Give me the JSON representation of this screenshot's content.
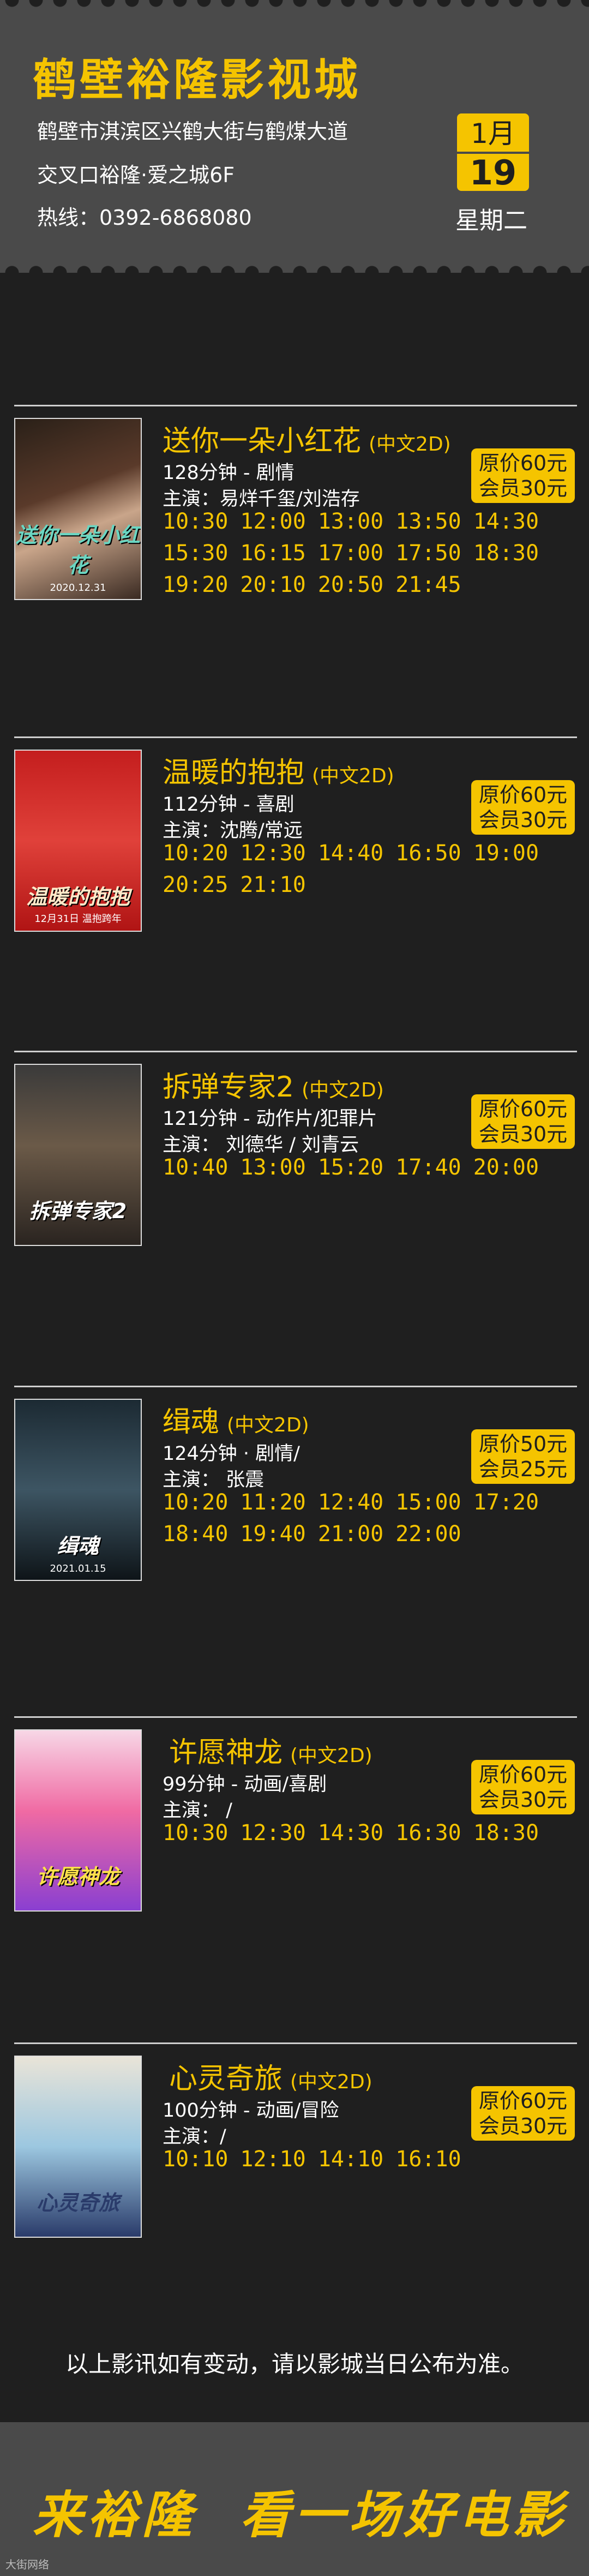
{
  "header": {
    "cinema_name": "鹤壁裕隆影视城",
    "address_line1": "鹤壁市淇滨区兴鹤大街与鹤煤大道",
    "address_line2": "交叉口裕隆·爱之城6F",
    "hotline": "热线：0392-6868080",
    "month": "1月",
    "day": "19",
    "weekday": "星期二"
  },
  "movies": [
    {
      "title": "送你一朵小红花",
      "format": "(中文2D)",
      "info": "128分钟 - 剧情",
      "cast": "主演：易烊千玺/刘浩存",
      "price_original": "原价60元",
      "price_member": "会员30元",
      "poster_title": "送你一朵小红花",
      "poster_date": "2020.12.31",
      "showtimes": [
        "10:30",
        "12:00",
        "13:00",
        "13:50",
        "14:30",
        "15:30",
        "16:15",
        "17:00",
        "17:50",
        "18:30",
        "19:20",
        "20:10",
        "20:50",
        "21:45"
      ]
    },
    {
      "title": "温暖的抱抱",
      "format": "(中文2D)",
      "info": "112分钟 - 喜剧",
      "cast": "主演：沈腾/常远",
      "price_original": "原价60元",
      "price_member": "会员30元",
      "poster_title": "温暖的抱抱",
      "poster_date": "12月31日 温抱跨年",
      "showtimes": [
        "10:20",
        "12:30",
        "14:40",
        "16:50",
        "19:00",
        "20:25",
        "21:10"
      ]
    },
    {
      "title": "拆弹专家2",
      "format": "(中文2D)",
      "info": "121分钟 - 动作片/犯罪片",
      "cast": "主演： 刘德华 / 刘青云",
      "price_original": "原价60元",
      "price_member": "会员30元",
      "poster_title": "拆弹专家2",
      "poster_date": "",
      "showtimes": [
        "10:40",
        "13:00",
        "15:20",
        "17:40",
        "20:00"
      ]
    },
    {
      "title": "缉魂",
      "format": "(中文2D)",
      "info": "124分钟 · 剧情/",
      "cast": "主演： 张震",
      "price_original": "原价50元",
      "price_member": "会员25元",
      "poster_title": "缉魂",
      "poster_date": "2021.01.15",
      "showtimes": [
        "10:20",
        "11:20",
        "12:40",
        "15:00",
        "17:20",
        "18:40",
        "19:40",
        "21:00",
        "22:00"
      ]
    },
    {
      "title": "许愿神龙",
      "format": "(中文2D)",
      "info": "99分钟 - 动画/喜剧",
      "cast": "主演： /",
      "price_original": "原价60元",
      "price_member": "会员30元",
      "poster_title": "许愿神龙",
      "poster_date": "",
      "showtimes": [
        "10:30",
        "12:30",
        "14:30",
        "16:30",
        "18:30"
      ]
    },
    {
      "title": "心灵奇旅",
      "format": "(中文2D)",
      "info": "100分钟 - 动画/冒险",
      "cast": "主演：/",
      "price_original": "原价60元",
      "price_member": "会员30元",
      "poster_title": "心灵奇旅",
      "poster_date": "",
      "showtimes": [
        "10:10",
        "12:10",
        "14:10",
        "16:10"
      ]
    }
  ],
  "notice": "以上影讯如有变动，请以影城当日公布为准。",
  "footer": {
    "slogan_left": "来裕隆",
    "slogan_right": "看一场好电影",
    "watermark": "大街网络"
  },
  "colors": {
    "accent": "#f5c400",
    "background": "#1f1f1f",
    "panel": "#4a4a4a"
  }
}
